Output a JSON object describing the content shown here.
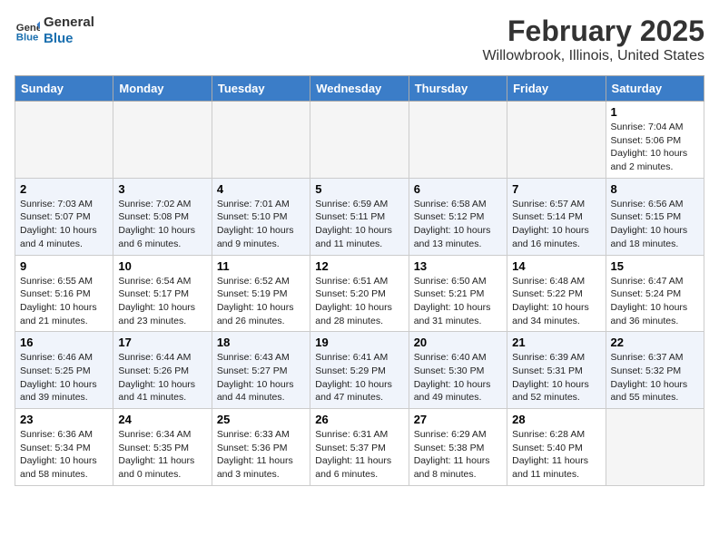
{
  "logo": {
    "line1": "General",
    "line2": "Blue"
  },
  "title": "February 2025",
  "subtitle": "Willowbrook, Illinois, United States",
  "headers": [
    "Sunday",
    "Monday",
    "Tuesday",
    "Wednesday",
    "Thursday",
    "Friday",
    "Saturday"
  ],
  "weeks": [
    [
      {
        "day": "",
        "info": ""
      },
      {
        "day": "",
        "info": ""
      },
      {
        "day": "",
        "info": ""
      },
      {
        "day": "",
        "info": ""
      },
      {
        "day": "",
        "info": ""
      },
      {
        "day": "",
        "info": ""
      },
      {
        "day": "1",
        "info": "Sunrise: 7:04 AM\nSunset: 5:06 PM\nDaylight: 10 hours\nand 2 minutes."
      }
    ],
    [
      {
        "day": "2",
        "info": "Sunrise: 7:03 AM\nSunset: 5:07 PM\nDaylight: 10 hours\nand 4 minutes."
      },
      {
        "day": "3",
        "info": "Sunrise: 7:02 AM\nSunset: 5:08 PM\nDaylight: 10 hours\nand 6 minutes."
      },
      {
        "day": "4",
        "info": "Sunrise: 7:01 AM\nSunset: 5:10 PM\nDaylight: 10 hours\nand 9 minutes."
      },
      {
        "day": "5",
        "info": "Sunrise: 6:59 AM\nSunset: 5:11 PM\nDaylight: 10 hours\nand 11 minutes."
      },
      {
        "day": "6",
        "info": "Sunrise: 6:58 AM\nSunset: 5:12 PM\nDaylight: 10 hours\nand 13 minutes."
      },
      {
        "day": "7",
        "info": "Sunrise: 6:57 AM\nSunset: 5:14 PM\nDaylight: 10 hours\nand 16 minutes."
      },
      {
        "day": "8",
        "info": "Sunrise: 6:56 AM\nSunset: 5:15 PM\nDaylight: 10 hours\nand 18 minutes."
      }
    ],
    [
      {
        "day": "9",
        "info": "Sunrise: 6:55 AM\nSunset: 5:16 PM\nDaylight: 10 hours\nand 21 minutes."
      },
      {
        "day": "10",
        "info": "Sunrise: 6:54 AM\nSunset: 5:17 PM\nDaylight: 10 hours\nand 23 minutes."
      },
      {
        "day": "11",
        "info": "Sunrise: 6:52 AM\nSunset: 5:19 PM\nDaylight: 10 hours\nand 26 minutes."
      },
      {
        "day": "12",
        "info": "Sunrise: 6:51 AM\nSunset: 5:20 PM\nDaylight: 10 hours\nand 28 minutes."
      },
      {
        "day": "13",
        "info": "Sunrise: 6:50 AM\nSunset: 5:21 PM\nDaylight: 10 hours\nand 31 minutes."
      },
      {
        "day": "14",
        "info": "Sunrise: 6:48 AM\nSunset: 5:22 PM\nDaylight: 10 hours\nand 34 minutes."
      },
      {
        "day": "15",
        "info": "Sunrise: 6:47 AM\nSunset: 5:24 PM\nDaylight: 10 hours\nand 36 minutes."
      }
    ],
    [
      {
        "day": "16",
        "info": "Sunrise: 6:46 AM\nSunset: 5:25 PM\nDaylight: 10 hours\nand 39 minutes."
      },
      {
        "day": "17",
        "info": "Sunrise: 6:44 AM\nSunset: 5:26 PM\nDaylight: 10 hours\nand 41 minutes."
      },
      {
        "day": "18",
        "info": "Sunrise: 6:43 AM\nSunset: 5:27 PM\nDaylight: 10 hours\nand 44 minutes."
      },
      {
        "day": "19",
        "info": "Sunrise: 6:41 AM\nSunset: 5:29 PM\nDaylight: 10 hours\nand 47 minutes."
      },
      {
        "day": "20",
        "info": "Sunrise: 6:40 AM\nSunset: 5:30 PM\nDaylight: 10 hours\nand 49 minutes."
      },
      {
        "day": "21",
        "info": "Sunrise: 6:39 AM\nSunset: 5:31 PM\nDaylight: 10 hours\nand 52 minutes."
      },
      {
        "day": "22",
        "info": "Sunrise: 6:37 AM\nSunset: 5:32 PM\nDaylight: 10 hours\nand 55 minutes."
      }
    ],
    [
      {
        "day": "23",
        "info": "Sunrise: 6:36 AM\nSunset: 5:34 PM\nDaylight: 10 hours\nand 58 minutes."
      },
      {
        "day": "24",
        "info": "Sunrise: 6:34 AM\nSunset: 5:35 PM\nDaylight: 11 hours\nand 0 minutes."
      },
      {
        "day": "25",
        "info": "Sunrise: 6:33 AM\nSunset: 5:36 PM\nDaylight: 11 hours\nand 3 minutes."
      },
      {
        "day": "26",
        "info": "Sunrise: 6:31 AM\nSunset: 5:37 PM\nDaylight: 11 hours\nand 6 minutes."
      },
      {
        "day": "27",
        "info": "Sunrise: 6:29 AM\nSunset: 5:38 PM\nDaylight: 11 hours\nand 8 minutes."
      },
      {
        "day": "28",
        "info": "Sunrise: 6:28 AM\nSunset: 5:40 PM\nDaylight: 11 hours\nand 11 minutes."
      },
      {
        "day": "",
        "info": ""
      }
    ]
  ]
}
